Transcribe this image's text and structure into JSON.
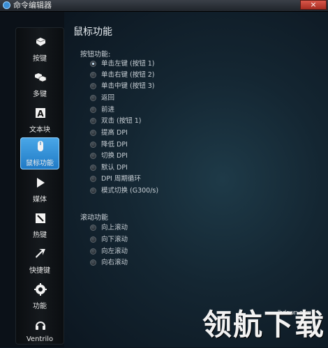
{
  "window": {
    "title": "命令编辑器",
    "close_label": "×"
  },
  "sidebar": {
    "items": [
      {
        "label": "按键",
        "icon": "key-icon"
      },
      {
        "label": "多键",
        "icon": "multi-key-icon"
      },
      {
        "label": "文本块",
        "icon": "text-block-icon"
      },
      {
        "label": "鼠标功能",
        "icon": "mouse-icon",
        "active": true
      },
      {
        "label": "媒体",
        "icon": "play-icon"
      },
      {
        "label": "热键",
        "icon": "hotkey-icon"
      },
      {
        "label": "快捷键",
        "icon": "shortcut-arrow-icon"
      },
      {
        "label": "功能",
        "icon": "gear-icon"
      },
      {
        "label": "Ventrilo",
        "icon": "headset-icon"
      }
    ]
  },
  "main": {
    "title": "鼠标功能",
    "button_section": {
      "label": "按钮功能:",
      "options": [
        {
          "label": "单击左键 (按钮 1)",
          "checked": true
        },
        {
          "label": "单击右键 (按钮 2)"
        },
        {
          "label": "单击中键 (按钮 3)"
        },
        {
          "label": "返回"
        },
        {
          "label": "前进"
        },
        {
          "label": "双击 (按钮 1)"
        },
        {
          "label": "提高 DPI"
        },
        {
          "label": "降低 DPI"
        },
        {
          "label": "切换 DPI"
        },
        {
          "label": "默认 DPI"
        },
        {
          "label": "DPI 周期循环"
        },
        {
          "label": "模式切换 (G300/s)"
        }
      ]
    },
    "scroll_section": {
      "label": "滚动功能",
      "options": [
        {
          "label": "向上滚动"
        },
        {
          "label": "向下滚动"
        },
        {
          "label": "向左滚动"
        },
        {
          "label": "向右滚动"
        }
      ]
    }
  },
  "watermark": {
    "logo": "领航下载",
    "site": "lhdown.com"
  },
  "colors": {
    "accent": "#2a8ad6",
    "background": "#142632"
  }
}
